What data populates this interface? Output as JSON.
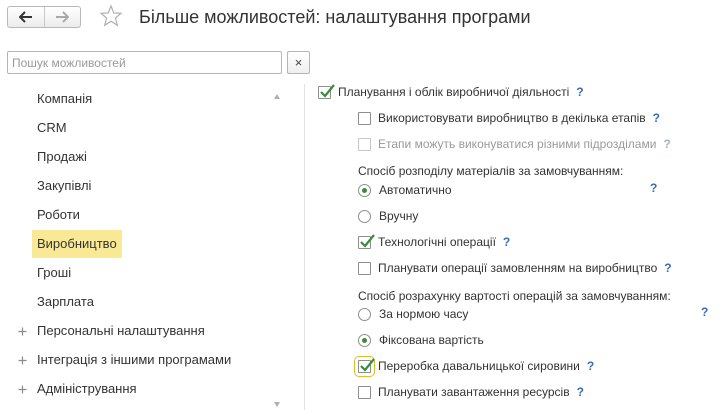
{
  "header": {
    "title": "Більше можливостей: налаштування програми"
  },
  "search": {
    "placeholder": "Пошук можливостей",
    "clear_label": "×"
  },
  "sidebar": {
    "items": [
      {
        "label": "Компанія"
      },
      {
        "label": "CRM"
      },
      {
        "label": "Продажі"
      },
      {
        "label": "Закупівлі"
      },
      {
        "label": "Роботи"
      },
      {
        "label": "Виробництво",
        "selected": true
      },
      {
        "label": "Гроші"
      },
      {
        "label": "Зарплата"
      }
    ],
    "groups": [
      {
        "label": "Персональні налаштування"
      },
      {
        "label": "Інтеграція з іншими програмами"
      },
      {
        "label": "Адміністрування"
      }
    ]
  },
  "settings": {
    "main": {
      "label": "Планування і облік виробничої діяльності",
      "checked": true,
      "help": "?"
    },
    "multi_stage": {
      "label": "Використовувати виробництво в декілька етапів",
      "checked": false,
      "help": "?"
    },
    "stages_divisions": {
      "label": "Етапи можуть виконуватися різними підрозділами",
      "checked": false,
      "disabled": true,
      "help": "?"
    },
    "materials_section": "Спосіб розподілу матеріалів за замовчуванням:",
    "materials_options": [
      {
        "label": "Автоматично",
        "selected": true
      },
      {
        "label": "Вручну",
        "selected": false
      }
    ],
    "materials_help": "?",
    "tech_ops": {
      "label": "Технологічні операції",
      "checked": true,
      "help": "?"
    },
    "plan_ops": {
      "label": "Планувати операції замовленням на виробництво",
      "checked": false,
      "help": "?"
    },
    "cost_section": "Спосіб розрахунку вартості операцій за замовчуванням:",
    "cost_options": [
      {
        "label": "За нормою часу",
        "selected": false
      },
      {
        "label": "Фіксована вартість",
        "selected": true
      }
    ],
    "cost_help": "?",
    "tolling": {
      "label": "Переробка давальницької сировини",
      "checked": true,
      "help": "?"
    },
    "plan_resources": {
      "label": "Планувати завантаження ресурсів",
      "checked": false,
      "help": "?"
    }
  },
  "colors": {
    "selection": "#f9e996",
    "check": "#3c8a3c",
    "help": "#3a6cb0"
  }
}
